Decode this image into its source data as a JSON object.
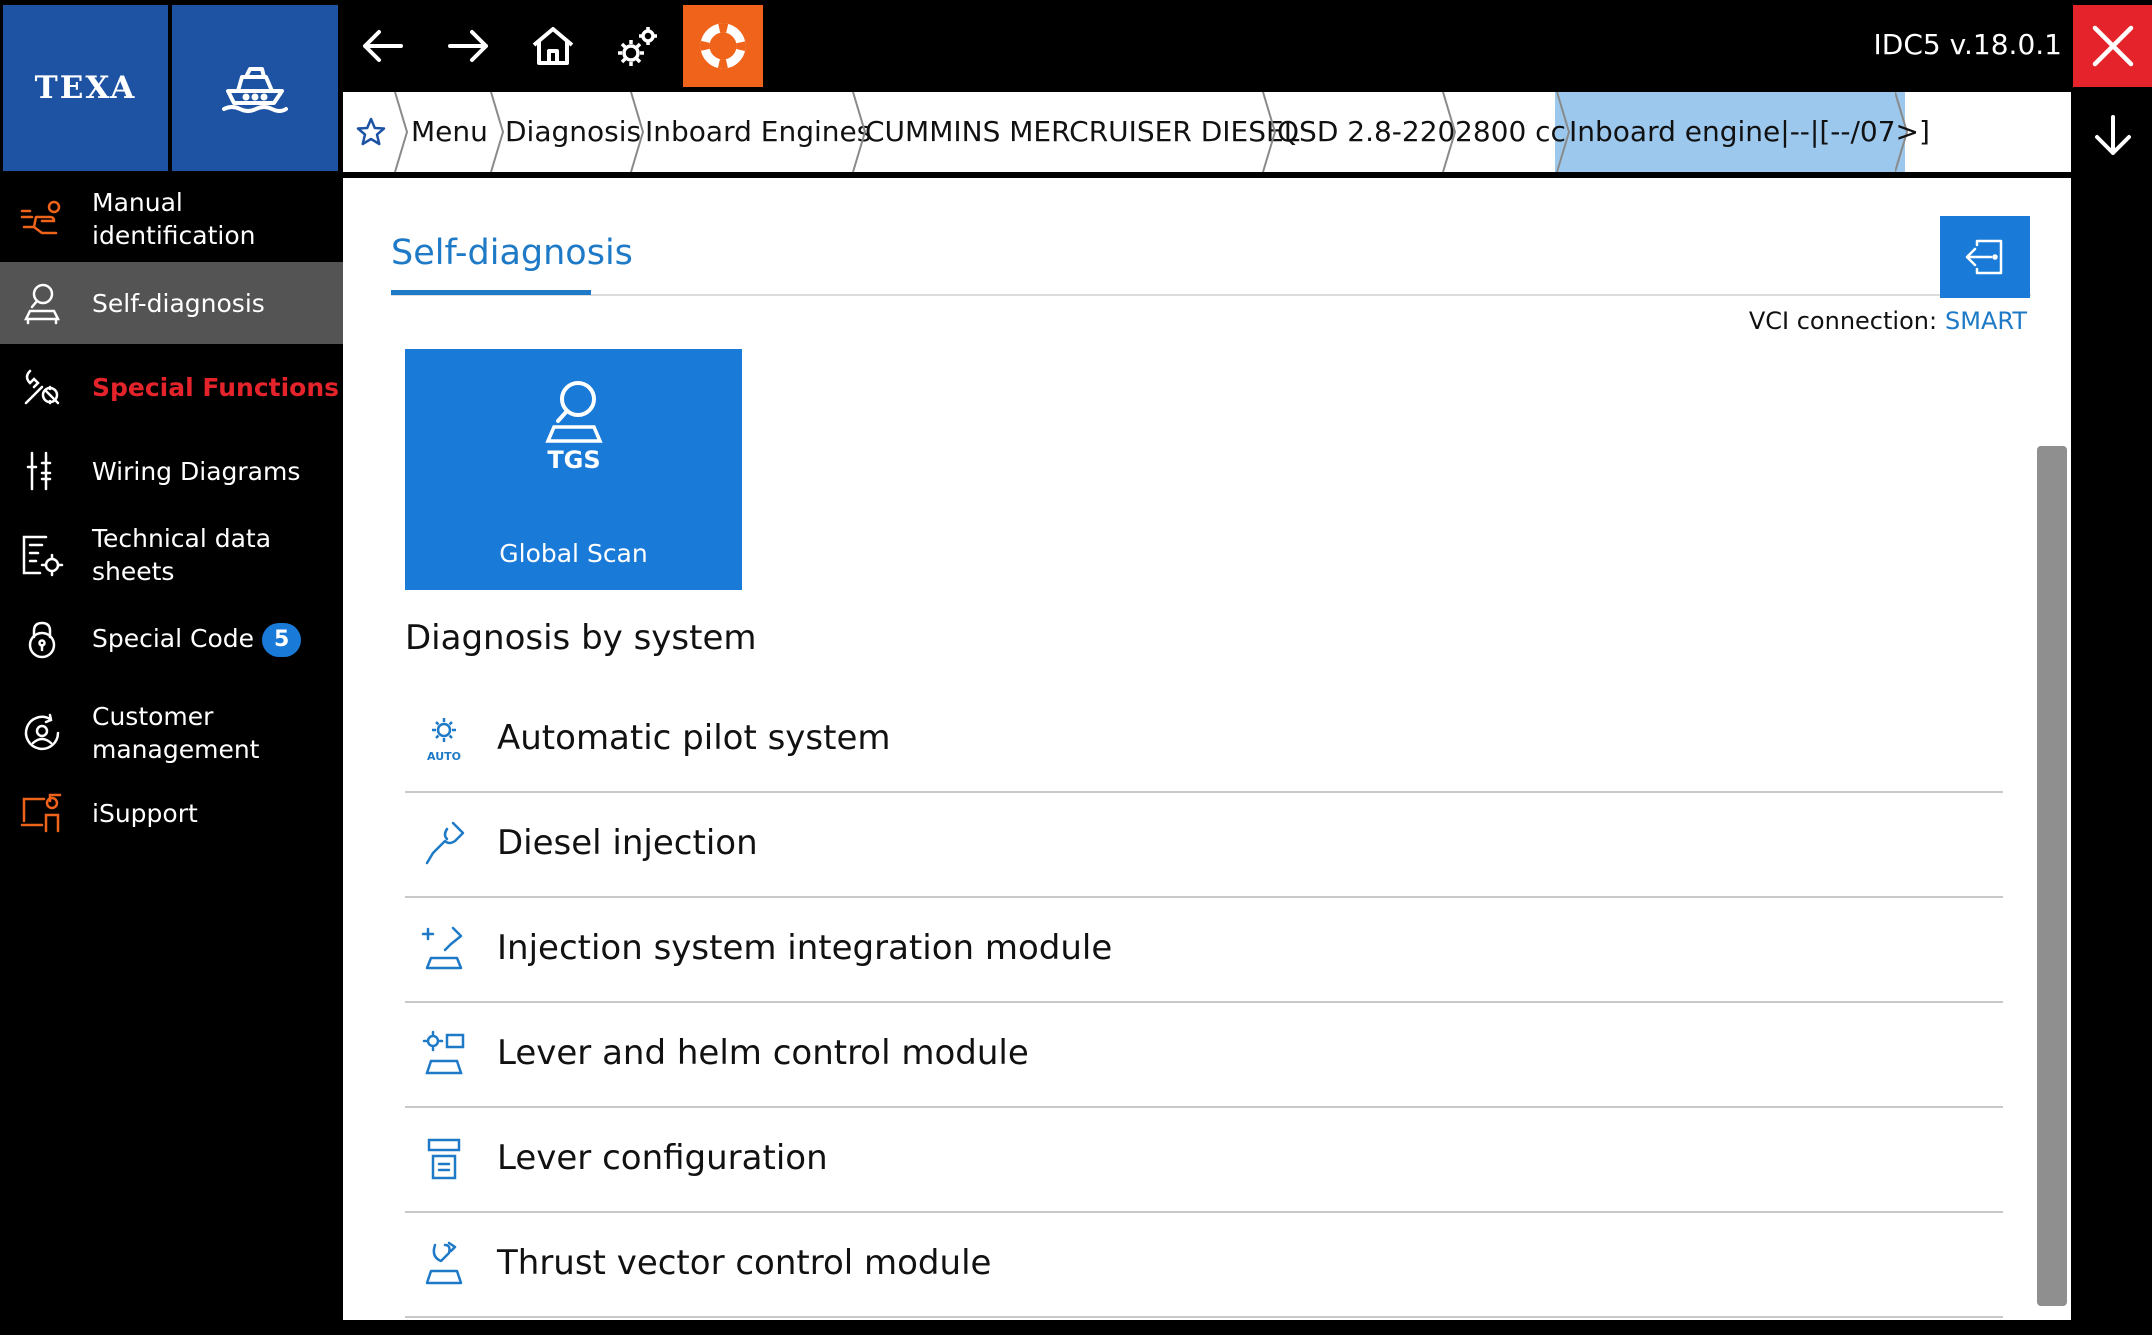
{
  "app": {
    "brand": "TEXA",
    "version": "IDC5 v.18.0.1"
  },
  "breadcrumbs": [
    "Menu",
    "Diagnosis",
    "Inboard Engines",
    "CUMMINS MERCRUISER DIESEL",
    "QSD 2.8-220",
    "2800 cc",
    "Inboard engine|--|[--/07>]"
  ],
  "sidebar": {
    "items": [
      {
        "label": "Manual identification",
        "icon": "hand-pointing-icon"
      },
      {
        "label": "Self-diagnosis",
        "icon": "magnifier-car-icon",
        "active": true
      },
      {
        "label": "Special Functions",
        "icon": "tools-icon"
      },
      {
        "label": "Wiring Diagrams",
        "icon": "wiring-icon"
      },
      {
        "label": "Technical data sheets",
        "icon": "datasheet-gear-icon"
      },
      {
        "label": "Special Code",
        "icon": "lock-icon",
        "badge": "5"
      },
      {
        "label": "Customer management",
        "icon": "customer-icon"
      },
      {
        "label": "iSupport",
        "icon": "support-icon"
      }
    ]
  },
  "main": {
    "tab": "Self-diagnosis",
    "vci_label": "VCI connection:",
    "vci_value": "SMART",
    "tile": {
      "label": "Global Scan",
      "icon_text": "TGS"
    },
    "section_title": "Diagnosis by system",
    "systems": [
      {
        "label": "Automatic pilot system",
        "icon_text": "AUTO"
      },
      {
        "label": "Diesel injection"
      },
      {
        "label": "Injection system integration module"
      },
      {
        "label": "Lever and helm control module"
      },
      {
        "label": "Lever configuration"
      },
      {
        "label": "Thrust vector control module"
      }
    ]
  },
  "colors": {
    "brand_blue": "#1e53a4",
    "accent_blue": "#1a7ad8",
    "help_orange": "#f0631a",
    "close_red": "#e4232a",
    "active_crumb": "#9cc8ee"
  }
}
